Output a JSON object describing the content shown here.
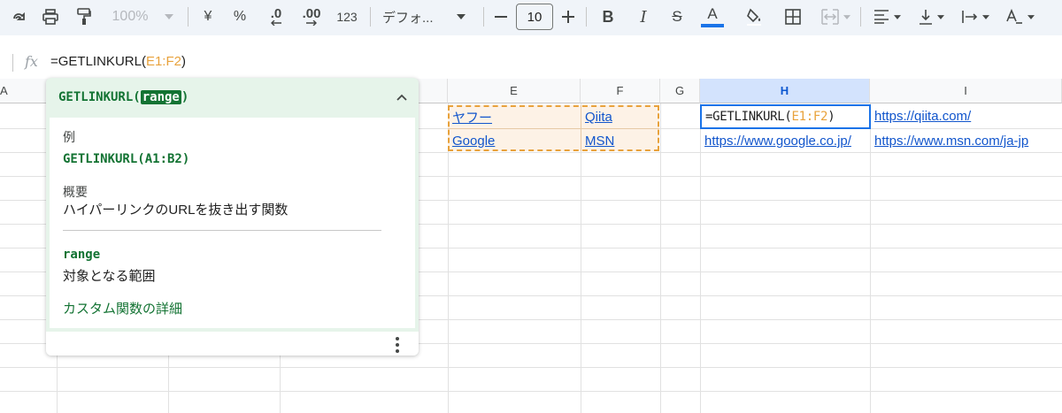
{
  "toolbar": {
    "zoom": "100%",
    "currency": "¥",
    "percent": "%",
    "dec_decrease": ".0",
    "dec_increase": ".00",
    "number_format": "123",
    "font": "デフォ...",
    "font_size": "10",
    "icons": [
      "redo-icon",
      "print-icon",
      "paint-format-icon",
      "bold-icon",
      "italic-icon",
      "strikethrough-icon",
      "text-color-icon",
      "fill-color-icon",
      "borders-icon",
      "merge-icon",
      "align-icon",
      "valign-icon",
      "text-wrap-icon",
      "text-rotate-icon"
    ],
    "text_color": "#1a73e8"
  },
  "formula_bar": {
    "fx": "fx",
    "prefix": "=GETLINKURL(",
    "ref": "E1:F2",
    "suffix": ")"
  },
  "columns": [
    {
      "label": "A"
    },
    {
      "label": "E"
    },
    {
      "label": "F"
    },
    {
      "label": "G"
    },
    {
      "label": "H"
    },
    {
      "label": "I"
    }
  ],
  "cells": {
    "e1": "ヤフー",
    "f1": "Qiita",
    "e2": "Google",
    "f2": "MSN",
    "h1_prefix": "=GETLINKURL(",
    "h1_ref": "E1:F2",
    "h1_suffix": ")",
    "i1": "https://qiita.com/",
    "h2": "https://www.google.co.jp/",
    "i2": "https://www.msn.com/ja-jp"
  },
  "help_popup": {
    "title_fn": "GETLINKURL(",
    "title_arg": "range",
    "title_end": ")",
    "example_label": "例",
    "example_code": "GETLINKURL(A1:B2)",
    "summary_label": "概要",
    "summary_text": "ハイパーリンクのURLを抜き出す関数",
    "param_name": "range",
    "param_desc": "対象となる範囲",
    "more_link": "カスタム関数の詳細"
  },
  "colors": {
    "accent": "#1a73e8",
    "range": "#e8a23c",
    "popup": "#e6f4ea",
    "link": "#1155cc"
  }
}
